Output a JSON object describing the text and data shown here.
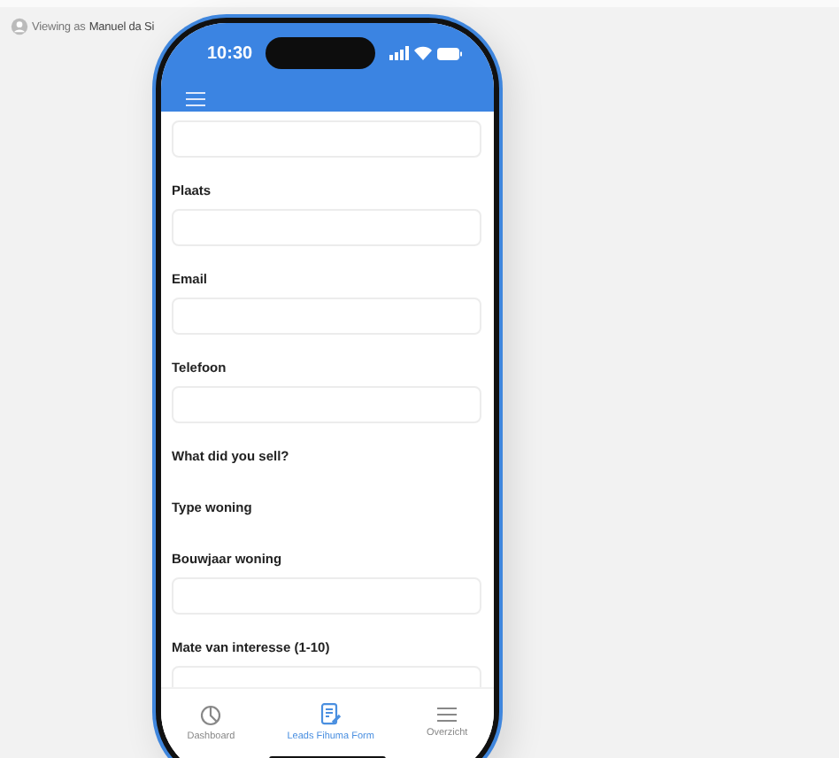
{
  "viewer": {
    "label": "Viewing as",
    "name": "Manuel da Si"
  },
  "phone": {
    "time": "10:30"
  },
  "form": {
    "fields": [
      {
        "kind": "input"
      },
      {
        "kind": "input",
        "label": "Plaats"
      },
      {
        "kind": "input",
        "label": "Email"
      },
      {
        "kind": "input",
        "label": "Telefoon"
      },
      {
        "kind": "heading",
        "label": "What did you sell?"
      },
      {
        "kind": "heading",
        "label": "Type woning"
      },
      {
        "kind": "input",
        "label": "Bouwjaar woning"
      },
      {
        "kind": "input",
        "label": "Mate van interesse (1-10)"
      }
    ]
  },
  "tab_bar": [
    {
      "label": "Dashboard",
      "kind": "chart",
      "selected": false
    },
    {
      "label": "Leads Fihuma Form",
      "kind": "form",
      "selected": true
    },
    {
      "label": "Overzicht",
      "kind": "list",
      "selected": false
    }
  ]
}
